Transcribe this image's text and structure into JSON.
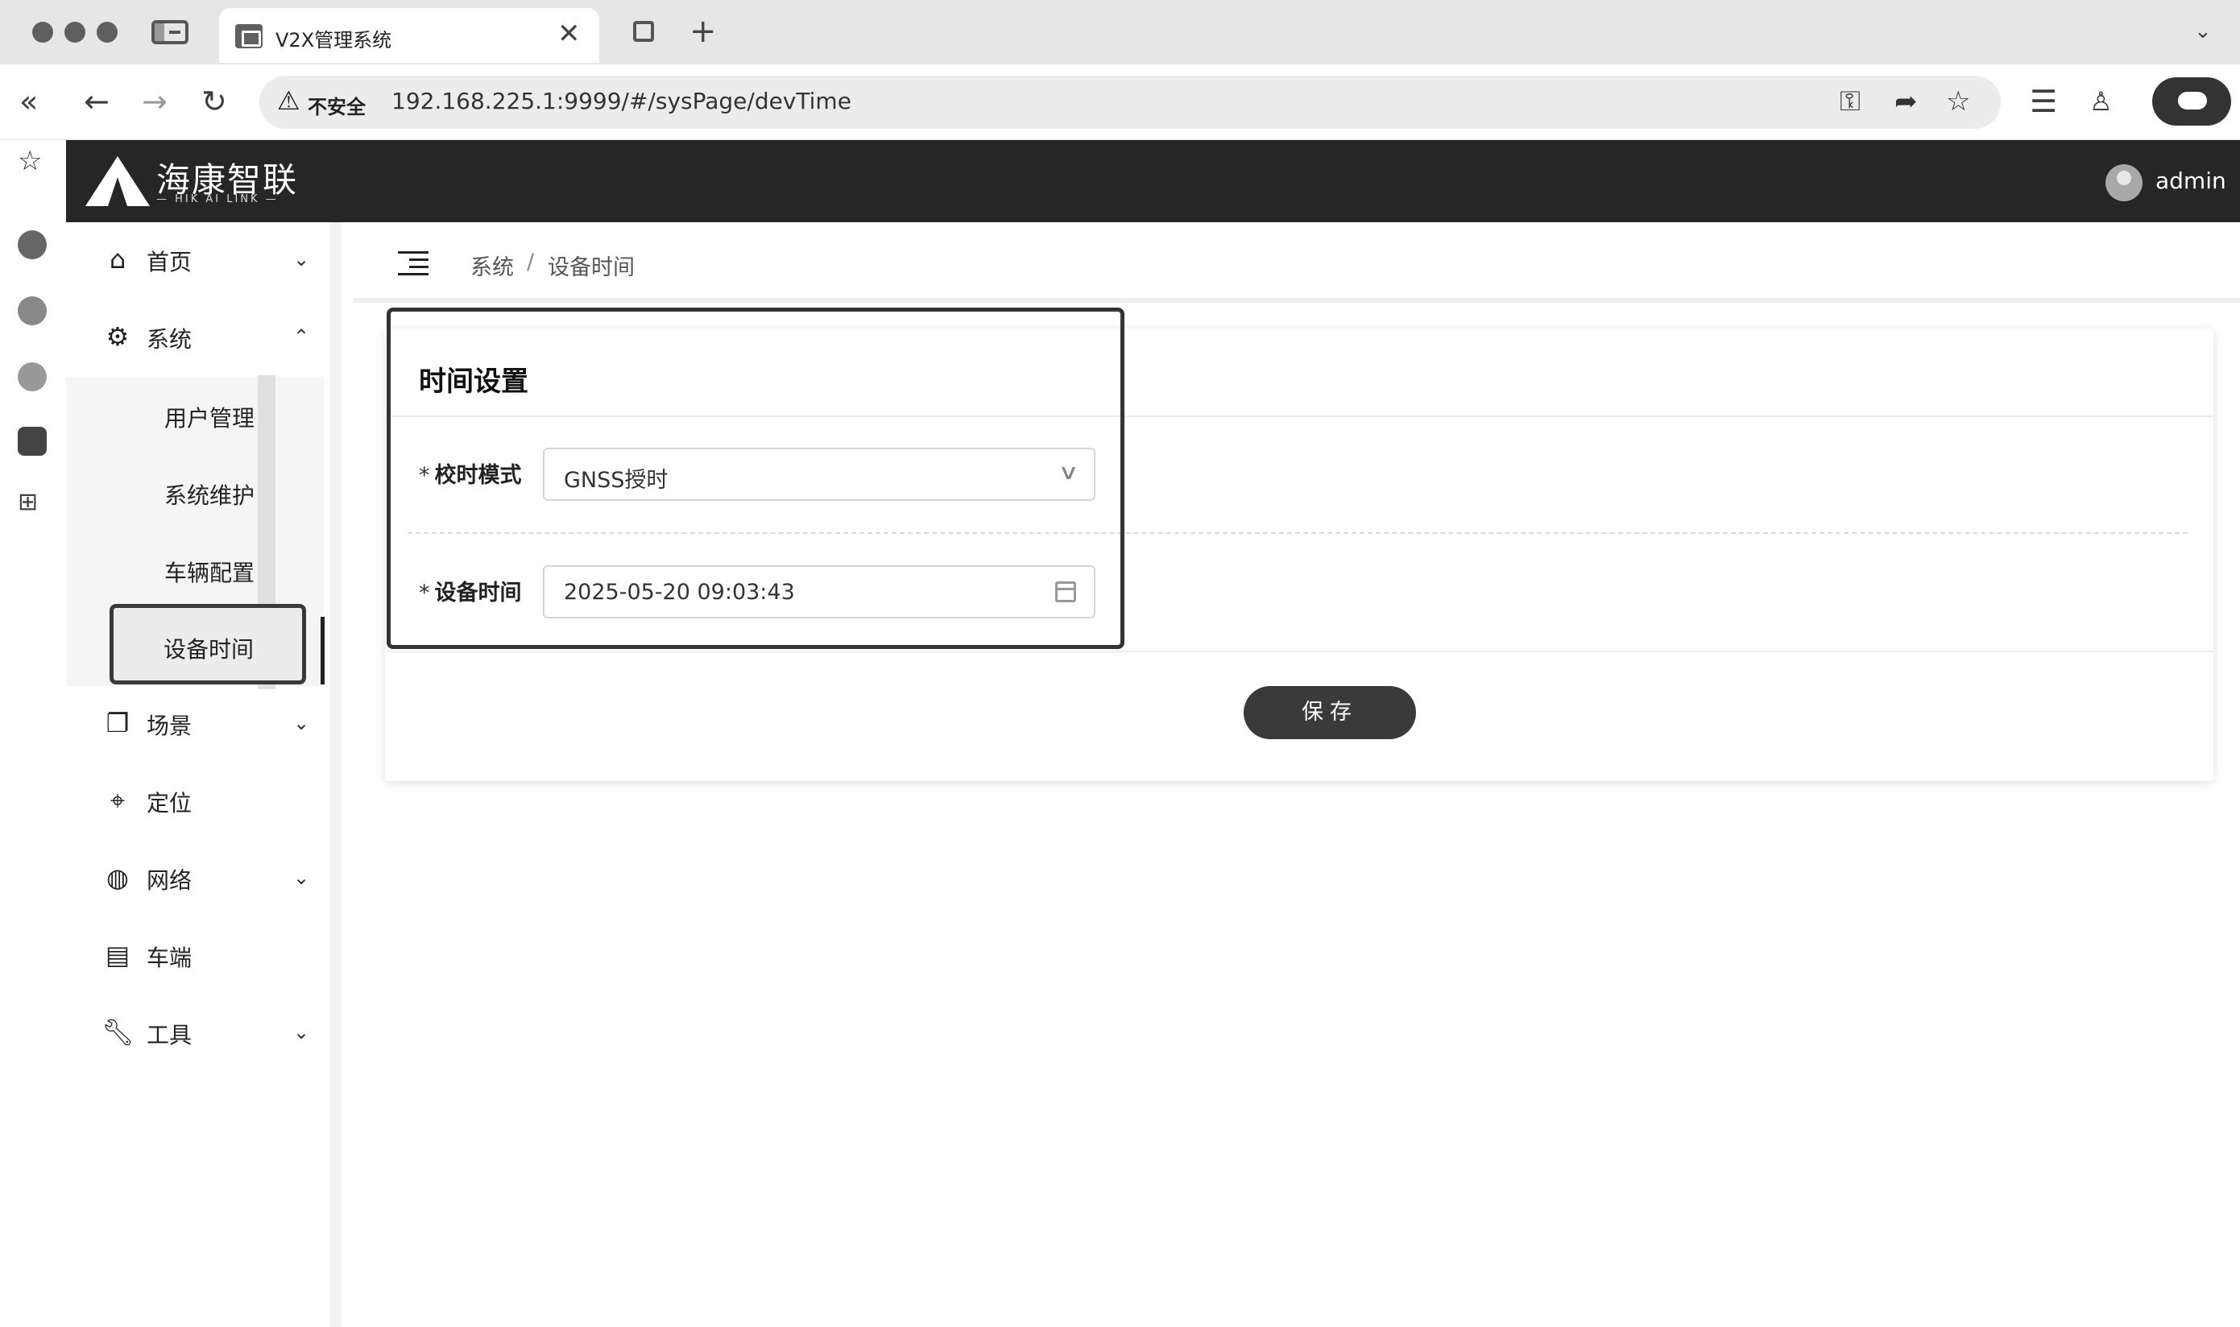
{
  "browser": {
    "tab_title": "V2X管理系统",
    "tab_close": "✕",
    "new_tab": "+",
    "security_label": "不安全",
    "url": "192.168.225.1:9999/#/sysPage/devTime"
  },
  "header": {
    "brand_cn": "海康智联",
    "brand_en": "— HIK AI LINK —",
    "username": "admin"
  },
  "nav": {
    "items": [
      {
        "label": "首页",
        "icon": "home-icon",
        "arrow": "⌄"
      },
      {
        "label": "系统",
        "icon": "system-gear-icon",
        "arrow": "⌃"
      },
      {
        "label": "场景",
        "icon": "scene-icon",
        "arrow": "⌄"
      },
      {
        "label": "定位",
        "icon": "location-pin-icon",
        "arrow": ""
      },
      {
        "label": "网络",
        "icon": "globe-icon",
        "arrow": "⌄"
      },
      {
        "label": "车端",
        "icon": "vehicle-terminal-icon",
        "arrow": ""
      },
      {
        "label": "工具",
        "icon": "wrench-icon",
        "arrow": "⌄"
      }
    ],
    "sub_items": [
      "用户管理",
      "系统维护",
      "车辆配置",
      "设备时间"
    ],
    "active_sub": "设备时间"
  },
  "breadcrumb": [
    "系统",
    "设备时间"
  ],
  "breadcrumb_sep": "/",
  "card": {
    "title": "时间设置",
    "required_mark": "*",
    "timing_mode_label": "校时模式",
    "timing_mode_value": "GNSS授时",
    "device_time_label": "设备时间",
    "device_time_value": "2025-05-20 09:03:43",
    "save_label": "保存"
  }
}
